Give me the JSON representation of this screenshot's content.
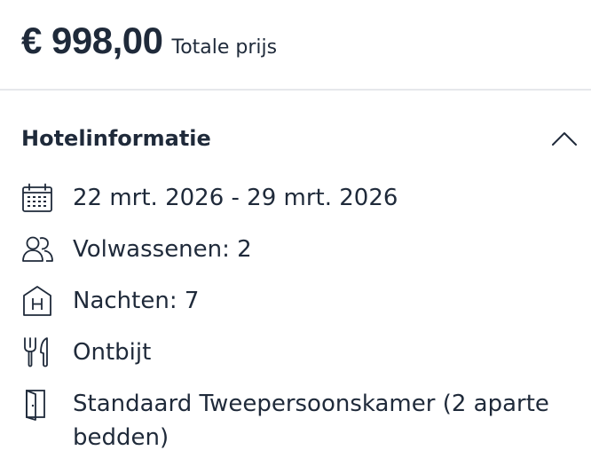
{
  "price": {
    "amount": "€ 998,00",
    "label": "Totale prijs"
  },
  "hotel_info": {
    "title": "Hotelinformatie",
    "toggle_icon": "chevron-up-icon",
    "items": [
      {
        "icon": "calendar-icon",
        "text": "22 mrt. 2026 - 29 mrt. 2026"
      },
      {
        "icon": "users-icon",
        "text": "Volwassenen: 2"
      },
      {
        "icon": "hotel-icon",
        "text": "Nachten: 7"
      },
      {
        "icon": "fork-knife-icon",
        "text": "Ontbijt"
      },
      {
        "icon": "door-icon",
        "text": "Standaard Tweepersoonskamer (2 aparte bedden)"
      }
    ]
  },
  "colors": {
    "text": "#1f2a3a",
    "divider": "#e6e8eb"
  }
}
